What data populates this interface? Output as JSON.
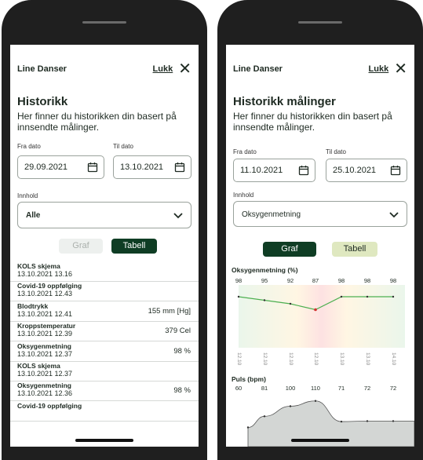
{
  "left": {
    "user_name": "Line Danser",
    "close_label": "Lukk",
    "title": "Historikk",
    "description": "Her finner du historikken din basert på innsendte målinger.",
    "from_label": "Fra dato",
    "from_value": "29.09.2021",
    "to_label": "Til dato",
    "to_value": "13.10.2021",
    "content_label": "Innhold",
    "content_value": "Alle",
    "graph_button": "Graf",
    "table_button": "Tabell",
    "active_view": "Tabell",
    "rows": [
      {
        "name": "KOLS skjema",
        "time": "13.10.2021 13.16",
        "value": ""
      },
      {
        "name": "Covid-19 oppfølging",
        "time": "13.10.2021 12.43",
        "value": ""
      },
      {
        "name": "Blodtrykk",
        "time": "13.10.2021 12.41",
        "value": "155 mm [Hg]"
      },
      {
        "name": "Kroppstemperatur",
        "time": "13.10.2021 12.39",
        "value": "379 Cel"
      },
      {
        "name": "Oksygenmetning",
        "time": "13.10.2021 12.37",
        "value": "98 %"
      },
      {
        "name": "KOLS skjema",
        "time": "13.10.2021 12.37",
        "value": ""
      },
      {
        "name": "Oksygenmetning",
        "time": "13.10.2021 12.36",
        "value": "98 %"
      },
      {
        "name": "Covid-19 oppfølging",
        "time": "",
        "value": ""
      }
    ]
  },
  "right": {
    "user_name": "Line Danser",
    "close_label": "Lukk",
    "title": "Historikk målinger",
    "description": "Her finner du historikken din basert på innsendte målinger.",
    "from_label": "Fra dato",
    "from_value": "11.10.2021",
    "to_label": "Til dato",
    "to_value": "25.10.2021",
    "content_label": "Innhold",
    "content_value": "Oksygenmetning",
    "graph_button": "Graf",
    "table_button": "Tabell",
    "active_view": "Graf",
    "x_ticks": [
      "12.10",
      "12.10",
      "12.10",
      "12.10",
      "13.10",
      "13.10",
      "14.10"
    ]
  },
  "chart_data": [
    {
      "type": "line",
      "title": "Oksygenmetning (%)",
      "x": [
        "12.10",
        "12.10",
        "12.10",
        "12.10",
        "13.10",
        "13.10",
        "14.10"
      ],
      "values": [
        98,
        95,
        92,
        87,
        98,
        98,
        98
      ],
      "ylim": [
        80,
        100
      ]
    },
    {
      "type": "area",
      "title": "Puls (bpm)",
      "values": [
        60,
        81,
        100,
        110,
        71,
        72,
        72
      ],
      "ylim": [
        40,
        120
      ]
    }
  ],
  "colors": {
    "dark_green": "#0f3d24",
    "light_green": "#dfe8c0",
    "disabled_bg": "#edf0ee",
    "disabled_text": "#aab0ac",
    "line_green": "#4caf50",
    "alert_red": "#d32f2f"
  }
}
